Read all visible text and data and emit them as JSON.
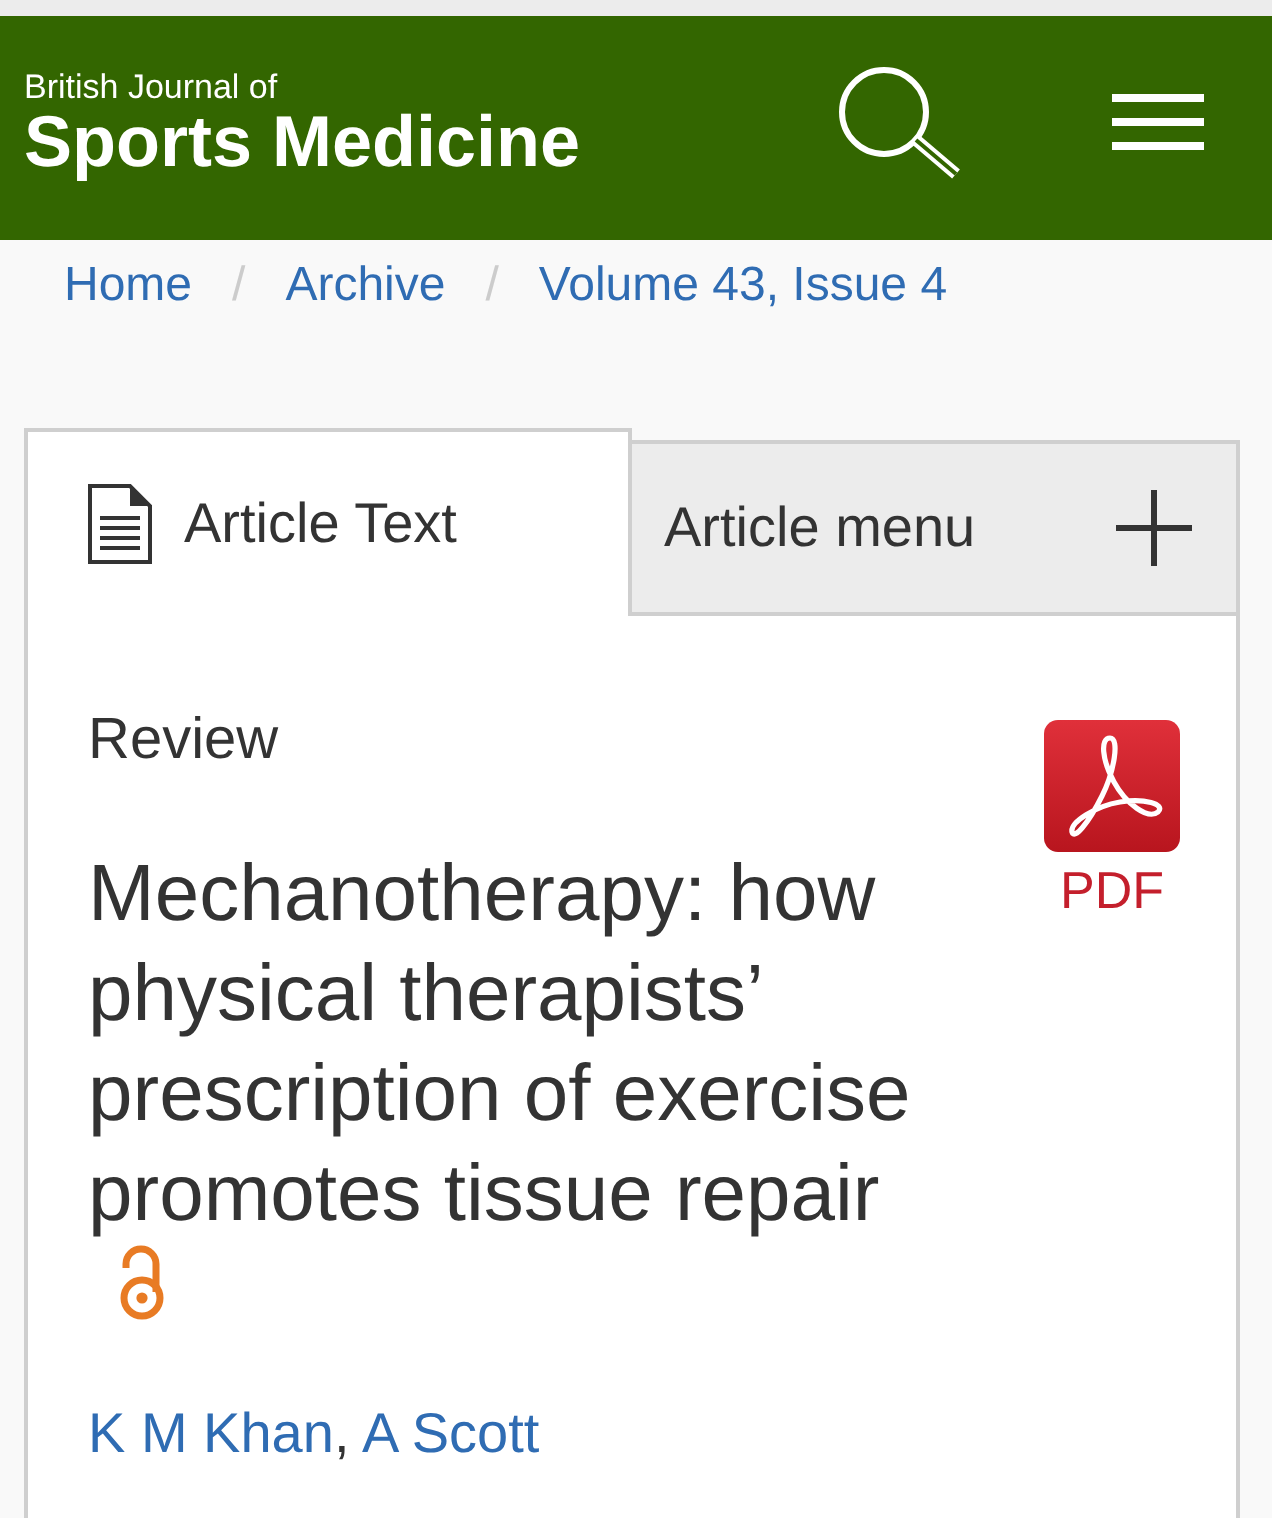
{
  "header": {
    "logo": {
      "line_1": "British Journal of",
      "line_2": "Sports Medicine"
    }
  },
  "breadcrumb": [
    {
      "label": "Home",
      "separator": "/"
    },
    {
      "label": "Archive",
      "separator": "/"
    },
    {
      "label": "Volume 43, Issue 4"
    }
  ],
  "tabs": [
    {
      "kind": "document",
      "label": "Article Text",
      "selected": true
    },
    {
      "kind": "menu",
      "label": "Article menu",
      "selected": false,
      "expanded": false
    }
  ],
  "article": {
    "type": "Review",
    "title": "Mechanotherapy: how physical therapists’ prescription of exercise promotes tissue repair",
    "open_access": true,
    "pdf_label": "PDF",
    "authors": [
      {
        "name": "K M Khan",
        "separator": ","
      },
      {
        "name": "A Scott"
      }
    ]
  }
}
